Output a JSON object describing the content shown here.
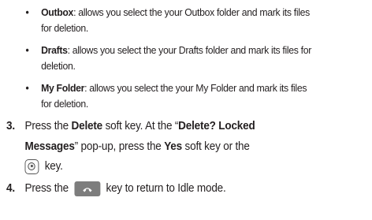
{
  "bullets": [
    {
      "term": "Outbox",
      "desc_line1": ": allows you select the your Outbox folder and mark its files",
      "desc_line2": "for deletion."
    },
    {
      "term": "Drafts",
      "desc_line1": ": allows you select the your Drafts folder and mark its files for",
      "desc_line2": "deletion."
    },
    {
      "term": "My Folder",
      "desc_line1": ": allows you select the your My Folder and mark its files",
      "desc_line2": "for deletion."
    }
  ],
  "steps": [
    {
      "number": "3.",
      "l1_pre": "Press the ",
      "l1_key": "Delete",
      "l1_post": " soft key. At the “",
      "l1_bold": "Delete? Locked",
      "l2_bold": "Messages",
      "l2_mid": "” pop-up, press the ",
      "l2_key": "Yes",
      "l2_post": " soft key or the",
      "l3_icon": "ok-key-icon",
      "l3_text": " key."
    },
    {
      "number": "4.",
      "pre": "Press the ",
      "icon": "end-key-icon",
      "post": " key to return to Idle mode."
    }
  ]
}
